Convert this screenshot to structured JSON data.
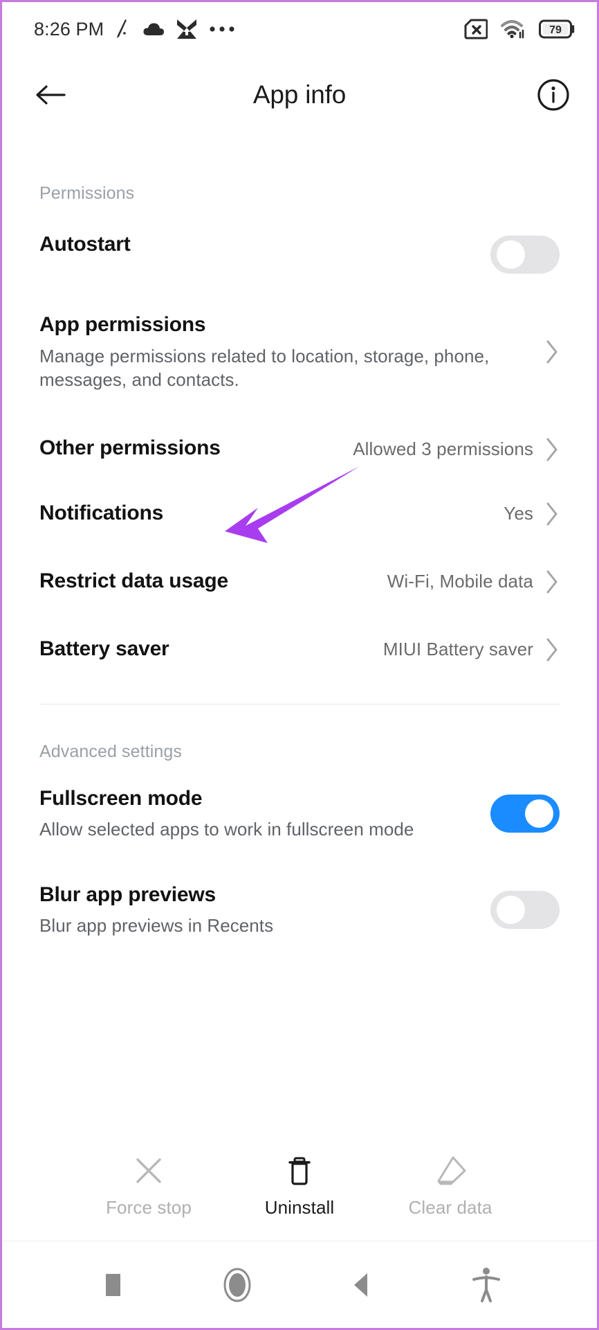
{
  "status_bar": {
    "time": "8:26 PM",
    "left_icons": [
      "dnd-slash-icon",
      "cloud-icon",
      "download-envelope-icon",
      "overflow-dots-icon"
    ],
    "right_icons": [
      "no-sim-icon",
      "wifi-icon"
    ],
    "battery_level": "79"
  },
  "header": {
    "back_label": "back-arrow",
    "title": "App info",
    "info_label": "info"
  },
  "sections": [
    {
      "label": "Permissions",
      "rows": [
        {
          "title": "Autostart",
          "sub": "",
          "value": "",
          "control": "toggle",
          "toggle_on": false
        },
        {
          "title": "App permissions",
          "sub": "Manage permissions related to location, storage, phone, messages, and contacts.",
          "value": "",
          "control": "chevron"
        },
        {
          "title": "Other permissions",
          "sub": "",
          "value": "Allowed 3 permissions",
          "control": "chevron"
        },
        {
          "title": "Notifications",
          "sub": "",
          "value": "Yes",
          "control": "chevron"
        },
        {
          "title": "Restrict data usage",
          "sub": "",
          "value": "Wi-Fi, Mobile data",
          "control": "chevron"
        },
        {
          "title": "Battery saver",
          "sub": "",
          "value": "MIUI Battery saver",
          "control": "chevron"
        }
      ]
    },
    {
      "label": "Advanced settings",
      "rows": [
        {
          "title": "Fullscreen mode",
          "sub": "Allow selected apps to work in fullscreen mode",
          "value": "",
          "control": "toggle",
          "toggle_on": true
        },
        {
          "title": "Blur app previews",
          "sub": "Blur app previews in Recents",
          "value": "",
          "control": "toggle",
          "toggle_on": false
        }
      ]
    }
  ],
  "annotation": {
    "type": "arrow",
    "color": "#a83df0",
    "points_to": "Restrict data usage"
  },
  "action_bar": [
    {
      "label": "Force stop",
      "icon": "close-x-icon",
      "enabled": false
    },
    {
      "label": "Uninstall",
      "icon": "trash-icon",
      "enabled": true
    },
    {
      "label": "Clear data",
      "icon": "eraser-icon",
      "enabled": false
    }
  ],
  "nav_bar": [
    {
      "name": "recents-square-icon"
    },
    {
      "name": "home-circle-icon"
    },
    {
      "name": "back-triangle-icon"
    },
    {
      "name": "accessibility-icon"
    }
  ],
  "colors": {
    "accent_blue": "#1a8cff",
    "annotation_purple": "#a83df0",
    "frame_purple": "#c77ae0"
  }
}
